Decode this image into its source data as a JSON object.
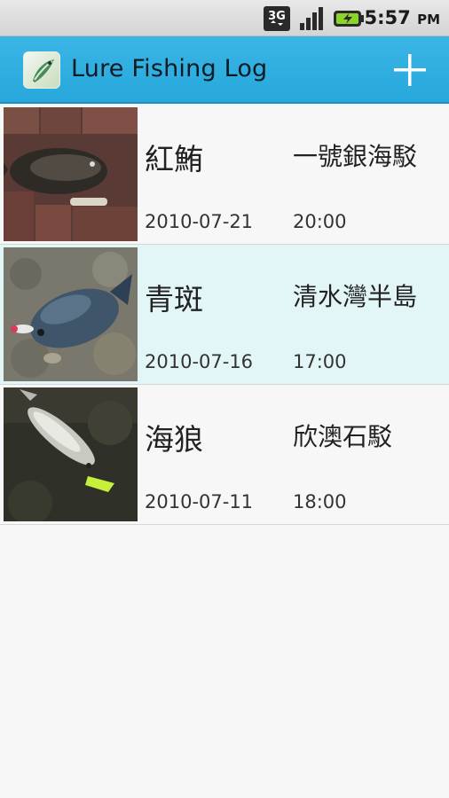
{
  "status_bar": {
    "network": "3G",
    "time": "5:57",
    "ampm": "PM",
    "icons": [
      "3g-icon",
      "signal-icon",
      "battery-charging-icon"
    ]
  },
  "action_bar": {
    "title": "Lure Fishing Log",
    "app_icon": "lure-app-icon",
    "add_icon": "plus-icon",
    "accent_color": "#2aa9dd"
  },
  "catches": [
    {
      "species": "紅鮪",
      "location": "一號銀海駁",
      "date": "2010-07-21",
      "time": "20:00",
      "thumb": "fish-photo-red-grouper",
      "selected": false
    },
    {
      "species": "青斑",
      "location": "清水灣半島",
      "date": "2010-07-16",
      "time": "17:00",
      "thumb": "fish-photo-green-grouper",
      "selected": true
    },
    {
      "species": "海狼",
      "location": "欣澳石駁",
      "date": "2010-07-11",
      "time": "18:00",
      "thumb": "fish-photo-seabass",
      "selected": false
    }
  ],
  "colors": {
    "selected_row": "#e2f6f7",
    "background": "#f7f7f7"
  }
}
